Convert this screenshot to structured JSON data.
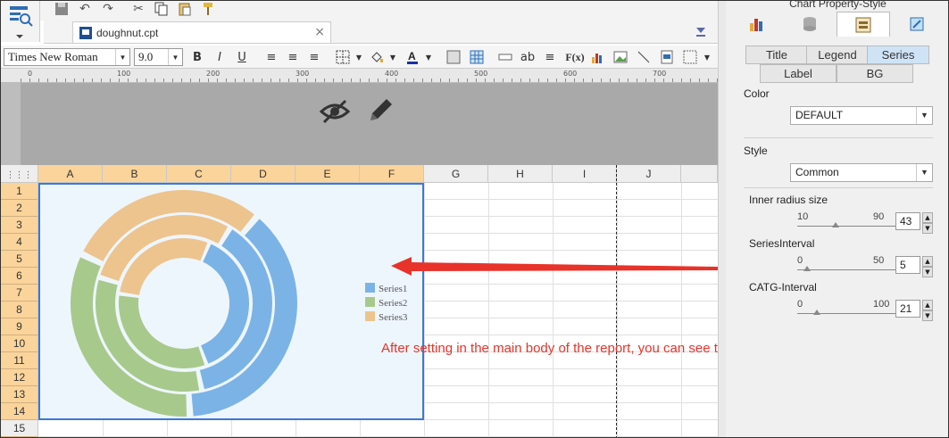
{
  "toolbar": {
    "font_name": "Times New Roman",
    "font_size": "9.0",
    "bold": "B",
    "italic": "I",
    "underline": "U",
    "text_ab": "ab",
    "formula": "F(x)"
  },
  "document": {
    "tab_name": "doughnut.cpt",
    "close_glyph": "×"
  },
  "ruler": {
    "labels": [
      "0",
      "100",
      "200",
      "300",
      "400",
      "500",
      "600",
      "700"
    ]
  },
  "grid": {
    "columns": [
      "A",
      "B",
      "C",
      "D",
      "E",
      "F",
      "G",
      "H",
      "I",
      "J"
    ],
    "rows": [
      "1",
      "2",
      "3",
      "4",
      "5",
      "6",
      "7",
      "8",
      "9",
      "10",
      "11",
      "12",
      "13",
      "14",
      "15"
    ]
  },
  "chart_data": {
    "type": "doughnut",
    "series": [
      {
        "name": "Series1",
        "color": "#7cb3e6",
        "values": [
          0.38
        ]
      },
      {
        "name": "Series2",
        "color": "#a8c98c",
        "values": [
          0.33
        ]
      },
      {
        "name": "Series3",
        "color": "#edc48e",
        "values": [
          0.29
        ]
      }
    ],
    "legend_position": "right"
  },
  "annotation": "After setting in the main body of the report, you can see the actual effects.",
  "panel": {
    "title": "Chart Property-Style",
    "tabs_row1": [
      "Title",
      "Legend",
      "Series"
    ],
    "tabs_row2": [
      "Label",
      "BG"
    ],
    "active_tab": "Series",
    "color_label": "Color",
    "color_value": "DEFAULT",
    "style_label": "Style",
    "style_value": "Common",
    "inner_radius": {
      "label": "Inner radius size",
      "min": "10",
      "max": "90",
      "value": "43"
    },
    "series_interval": {
      "label": "SeriesInterval",
      "min": "0",
      "max": "50",
      "value": "5"
    },
    "catg_interval": {
      "label": "CATG-Interval",
      "min": "0",
      "max": "100",
      "value": "21"
    }
  }
}
